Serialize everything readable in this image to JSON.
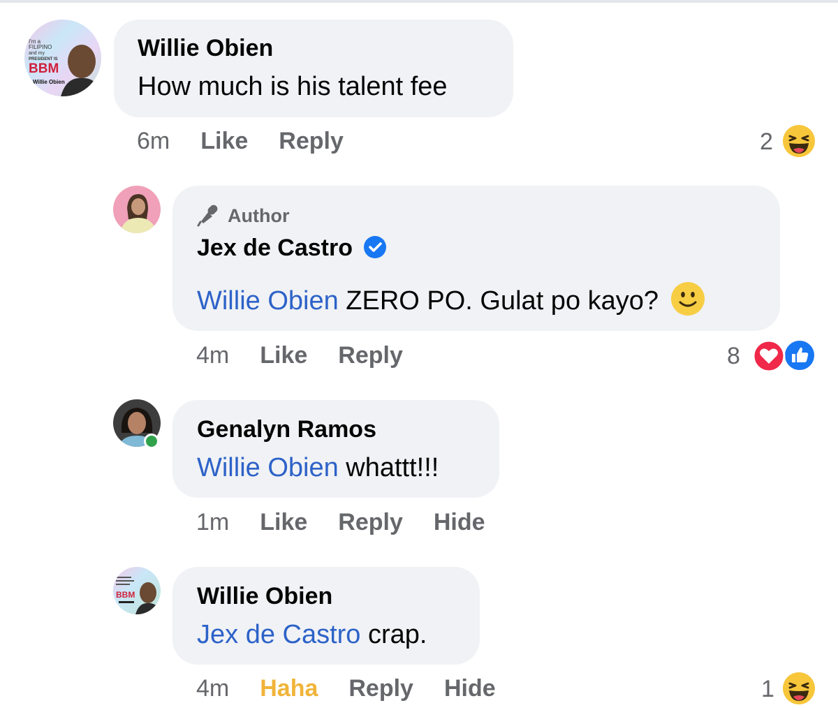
{
  "comments": [
    {
      "author": "Willie Obien",
      "avatar_text": {
        "line1": "I'm a",
        "line2": "FILIPINO",
        "line3": "and my",
        "line4": "PRESIDENT IS",
        "line5": "BBM",
        "line6": "Willie Obien"
      },
      "mention": "",
      "text": "How much is his talent fee",
      "time": "6m",
      "actions": [
        "Like",
        "Reply"
      ],
      "reaction_count": "2",
      "reactions": [
        "haha-icon"
      ]
    },
    {
      "badge": "Author",
      "author": "Jex de Castro",
      "verified": true,
      "mention": "Willie Obien",
      "text": " ZERO PO.  Gulat po kayo?",
      "emoji": "slightly-smiling-face-icon",
      "time": "4m",
      "actions": [
        "Like",
        "Reply"
      ],
      "reaction_count": "8",
      "reactions": [
        "love-icon",
        "like-icon"
      ]
    },
    {
      "author": "Genalyn Ramos",
      "online": true,
      "mention": "Willie Obien",
      "text": " whattt!!!",
      "time": "1m",
      "actions": [
        "Like",
        "Reply",
        "Hide"
      ]
    },
    {
      "author": "Willie Obien",
      "mention": "Jex de Castro",
      "text": " crap.",
      "time": "4m",
      "actions": [
        "Haha",
        "Reply",
        "Hide"
      ],
      "active_reaction_color": "#f0b43a",
      "reaction_count": "1",
      "reactions": [
        "haha-icon"
      ]
    }
  ],
  "colors": {
    "mention": "#2d62c8",
    "bubble": "#f0f2f5",
    "meta": "#65676b",
    "verified": "#1877f2",
    "online": "#31a24c"
  }
}
